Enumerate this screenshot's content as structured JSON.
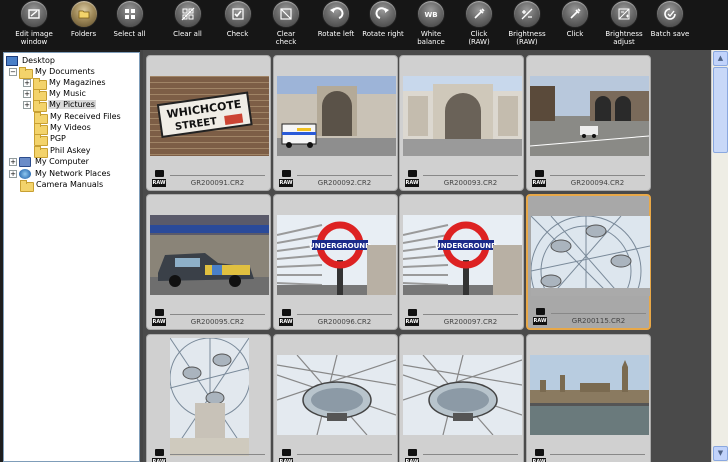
{
  "toolbar": {
    "buttons": [
      {
        "label": "Edit image\nwindow",
        "icon": "edit-window-icon"
      },
      {
        "label": "Folders",
        "icon": "folders-icon"
      },
      {
        "label": "Select all",
        "icon": "select-all-icon"
      },
      {
        "label": "Clear all",
        "icon": "clear-all-icon"
      },
      {
        "label": "Check",
        "icon": "check-icon"
      },
      {
        "label": "Clear\ncheck",
        "icon": "clear-check-icon"
      },
      {
        "label": "Rotate left",
        "icon": "rotate-left-icon"
      },
      {
        "label": "Rotate right",
        "icon": "rotate-right-icon"
      },
      {
        "label": "White\nbalance",
        "icon": "white-balance-icon"
      },
      {
        "label": "Click\n(RAW)",
        "icon": "eyedropper-raw-icon"
      },
      {
        "label": "Brightness\n(RAW)",
        "icon": "brightness-raw-icon"
      },
      {
        "label": "Click",
        "icon": "eyedropper-icon"
      },
      {
        "label": "Brightness\nadjust",
        "icon": "brightness-adjust-icon"
      },
      {
        "label": "Batch save",
        "icon": "batch-save-icon"
      }
    ],
    "wb_text": "WB"
  },
  "tree": {
    "items": [
      {
        "label": "Desktop",
        "type": "desktop",
        "expander": ""
      },
      {
        "label": "My Documents",
        "type": "folder",
        "expander": "−"
      },
      {
        "label": "My Magazines",
        "type": "folder",
        "expander": "+"
      },
      {
        "label": "My Music",
        "type": "folder",
        "expander": "+"
      },
      {
        "label": "My Pictures",
        "type": "folder",
        "expander": "+"
      },
      {
        "label": "My Received Files",
        "type": "folder",
        "expander": ""
      },
      {
        "label": "My Videos",
        "type": "folder",
        "expander": ""
      },
      {
        "label": "PGP",
        "type": "folder",
        "expander": ""
      },
      {
        "label": "Phil Askey",
        "type": "folder",
        "expander": ""
      },
      {
        "label": "My Computer",
        "type": "computer",
        "expander": "+"
      },
      {
        "label": "My Network Places",
        "type": "network",
        "expander": "+"
      },
      {
        "label": "Camera Manuals",
        "type": "folder",
        "expander": ""
      }
    ],
    "selected": "My Pictures"
  },
  "thumbnails": [
    {
      "name": "GR200091.CR2",
      "subject": "street-sign"
    },
    {
      "name": "GR200092.CR2",
      "subject": "ambulance-building"
    },
    {
      "name": "GR200093.CR2",
      "subject": "building-arch"
    },
    {
      "name": "GR200094.CR2",
      "subject": "bridge-street"
    },
    {
      "name": "GR200095.CR2",
      "subject": "taxi"
    },
    {
      "name": "GR200096.CR2",
      "subject": "underground-sign"
    },
    {
      "name": "GR200097.CR2",
      "subject": "underground-sign"
    },
    {
      "name": "GR200115.CR2",
      "subject": "london-eye",
      "selected": true
    },
    {
      "name": "",
      "subject": "london-eye-portrait"
    },
    {
      "name": "",
      "subject": "eye-pod"
    },
    {
      "name": "",
      "subject": "eye-pod"
    },
    {
      "name": "",
      "subject": "parliament"
    }
  ],
  "raw_badge": "RAW",
  "colors": {
    "selected_border": "#e8a848",
    "toolbar_bg": "#161616",
    "grid_bg": "#4a4a4a"
  }
}
